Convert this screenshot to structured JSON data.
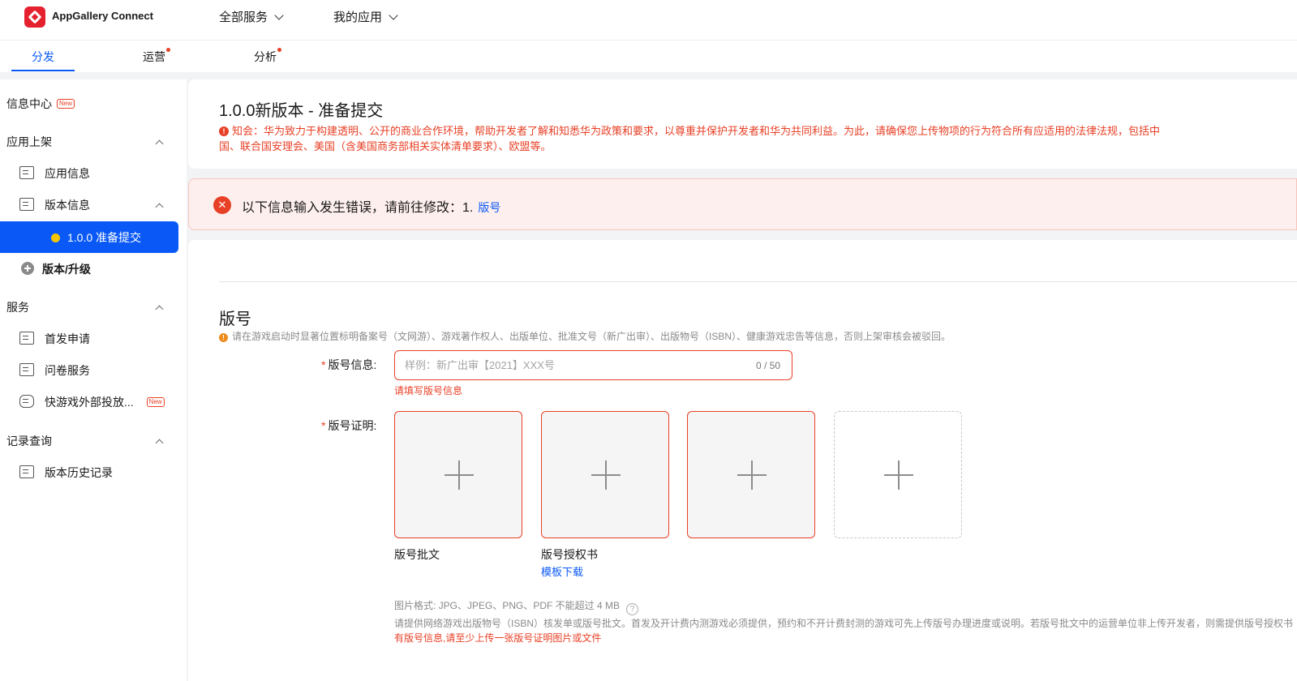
{
  "header": {
    "brand": "AppGallery Connect",
    "nav": [
      "全部服务",
      "我的应用"
    ]
  },
  "tabs": [
    {
      "label": "分发",
      "active": true,
      "dot": false
    },
    {
      "label": "运营",
      "active": false,
      "dot": true
    },
    {
      "label": "分析",
      "active": false,
      "dot": true
    }
  ],
  "sidebar": {
    "info_center": "信息中心",
    "new_badge": "New",
    "group_listing": "应用上架",
    "app_info": "应用信息",
    "version_info": "版本信息",
    "active_version": "1.0.0 准备提交",
    "version_upgrade": "版本/升级",
    "group_services": "服务",
    "first_release": "首发申请",
    "survey": "问卷服务",
    "quick_game": "快游戏外部投放...",
    "group_records": "记录查询",
    "version_history": "版本历史记录"
  },
  "page": {
    "title": "1.0.0新版本 - 准备提交",
    "notice_icon": "!",
    "notice": "知会：华为致力于构建透明、公开的商业合作环境，帮助开发者了解和知悉华为政策和要求，以尊重并保护开发者和华为共同利益。为此，请确保您上传物项的行为符合所有应适用的法律法规，包括中国、联合国安理会、美国（含美国商务部相关实体清单要求）、欧盟等。"
  },
  "error_bar": {
    "icon": "✕",
    "text": "以下信息输入发生错误，请前往修改：1.",
    "link": "版号"
  },
  "form": {
    "section_title": "版号",
    "section_tip_icon": "!",
    "section_tip": "请在游戏启动时显著位置标明备案号（文网游）、游戏著作权人、出版单位、批准文号（新广出审）、出版物号（ISBN）、健康游戏忠告等信息，否则上架审核会被驳回。",
    "required_mark": "*",
    "license_label": "版号信息:",
    "license_placeholder": "样例：新广出审【2021】XXX号",
    "license_counter": "0 / 50",
    "license_error": "请填写版号信息",
    "proof_label": "版号证明:",
    "upload_labels": [
      "版号批文",
      "版号授权书"
    ],
    "template_link": "模板下载",
    "format_hint": "图片格式: JPG、JPEG、PNG、PDF 不能超过 4 MB",
    "help_icon": "?",
    "isbn_hint": "请提供网络游戏出版物号（ISBN）核发单或版号批文。首发及开计费内测游戏必须提供，预约和不开计费封测的游戏可先上传版号办理进度或说明。若版号批文中的运营单位非上传开发者，则需提供版号授权书",
    "upload_error": "有版号信息,请至少上传一张版号证明图片或文件"
  },
  "colors": {
    "accent": "#0a59f7",
    "error": "#e84026",
    "warning": "#ed8c1f"
  }
}
